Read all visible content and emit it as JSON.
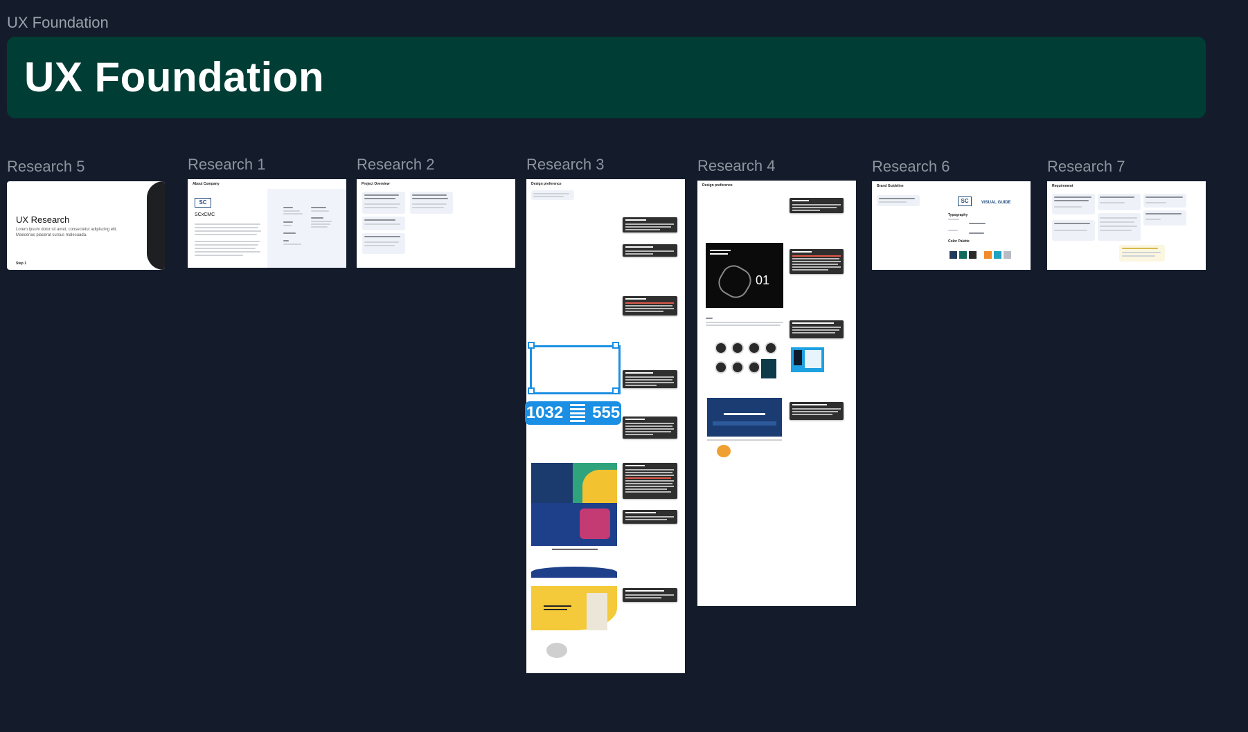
{
  "section_label": "UX Foundation",
  "banner": {
    "title": "UX Foundation"
  },
  "frames": [
    {
      "label": "Research 5"
    },
    {
      "label": "Research 1"
    },
    {
      "label": "Research 2"
    },
    {
      "label": "Research 3"
    },
    {
      "label": "Research 4"
    },
    {
      "label": "Research 6"
    },
    {
      "label": "Research 7"
    }
  ],
  "research5": {
    "title": "UX Research",
    "description": "Lorem ipsum dolor sit amet, consectetur adipiscing elit. Maecenas placerat cursus malesuada.",
    "step": "Step 1"
  },
  "research1": {
    "heading": "About Company",
    "company": "SCxCMC"
  },
  "research2": {
    "heading": "Project Overview"
  },
  "research3": {
    "heading": "Design preference"
  },
  "research4": {
    "heading": "Design preference",
    "hero_number": "01"
  },
  "research6": {
    "heading": "Brand Guideline",
    "guide_title": "VISUAL GUIDE",
    "typography_label": "Typography",
    "palette_label": "Color Palette"
  },
  "research7": {
    "heading": "Requirement"
  },
  "selection": {
    "width": "1032",
    "height": "555"
  },
  "colors": {
    "canvas_bg": "#141c2b",
    "banner_bg": "#003d35",
    "selection": "#1a8fe3"
  }
}
